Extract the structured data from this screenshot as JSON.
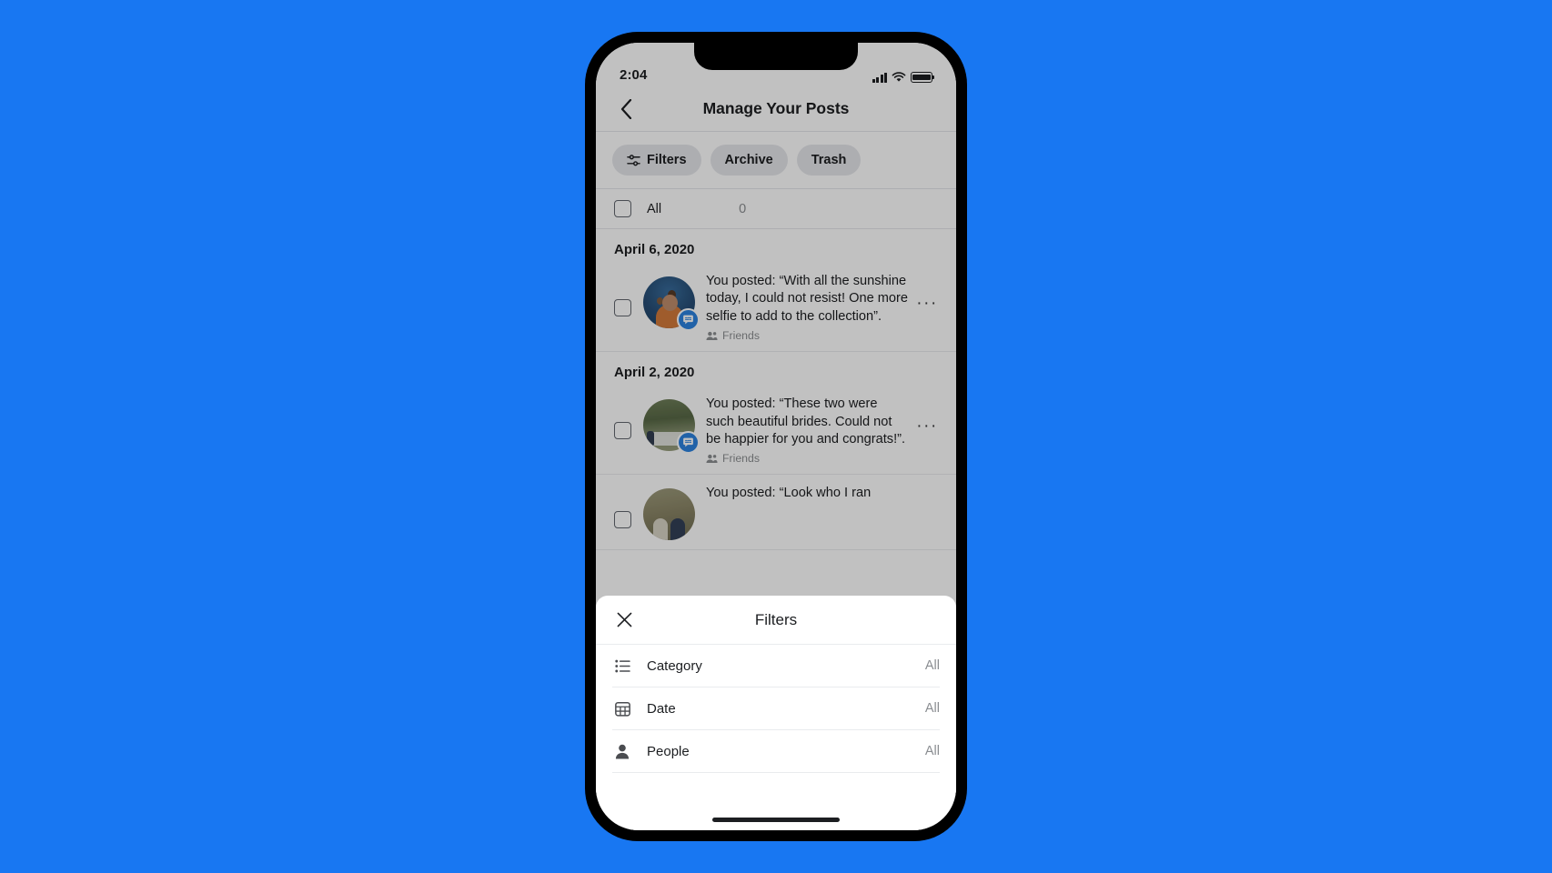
{
  "status_bar": {
    "time": "2:04",
    "signal_icon": "cellular-bars-icon",
    "wifi_icon": "wifi-icon",
    "battery_icon": "battery-icon"
  },
  "nav": {
    "back_icon": "chevron-left-icon",
    "title": "Manage Your Posts"
  },
  "chips": [
    {
      "label": "Filters",
      "icon": "sliders-icon"
    },
    {
      "label": "Archive",
      "icon": ""
    },
    {
      "label": "Trash",
      "icon": ""
    }
  ],
  "select_all": {
    "checkbox_icon": "checkbox-unchecked-icon",
    "label": "All",
    "count": "0"
  },
  "post_groups": [
    {
      "date": "April 6, 2020",
      "posts": [
        {
          "text": "You posted: “With all the sunshine today, I could not resist! One more selfie to add to the collection”.",
          "privacy": "Friends",
          "privacy_icon": "friends-icon",
          "thumb": "selfie-photo-thumbnail",
          "badge_icon": "comment-bubble-icon",
          "menu_icon": "more-options-icon"
        }
      ]
    },
    {
      "date": "April 2, 2020",
      "posts": [
        {
          "text": "You posted: “These two were such beautiful brides. Could not be happier for you and congrats!”.",
          "privacy": "Friends",
          "privacy_icon": "friends-icon",
          "thumb": "wedding-photo-thumbnail",
          "badge_icon": "comment-bubble-icon",
          "menu_icon": "more-options-icon"
        },
        {
          "text": "You posted: “Look who I ran",
          "privacy": "",
          "privacy_icon": "",
          "thumb": "couple-photo-thumbnail",
          "badge_icon": "comment-bubble-icon",
          "menu_icon": "more-options-icon"
        }
      ]
    }
  ],
  "sheet": {
    "close_icon": "close-icon",
    "title": "Filters",
    "rows": [
      {
        "label": "Category",
        "value": "All",
        "icon": "list-bullets-icon"
      },
      {
        "label": "Date",
        "value": "All",
        "icon": "calendar-icon"
      },
      {
        "label": "People",
        "value": "All",
        "icon": "person-icon"
      }
    ]
  },
  "colors": {
    "background": "#1877f2",
    "accent": "#1b84f5",
    "text_primary": "#1c1e21",
    "text_secondary": "#8a8d91",
    "chip_background": "#e4e6eb"
  }
}
